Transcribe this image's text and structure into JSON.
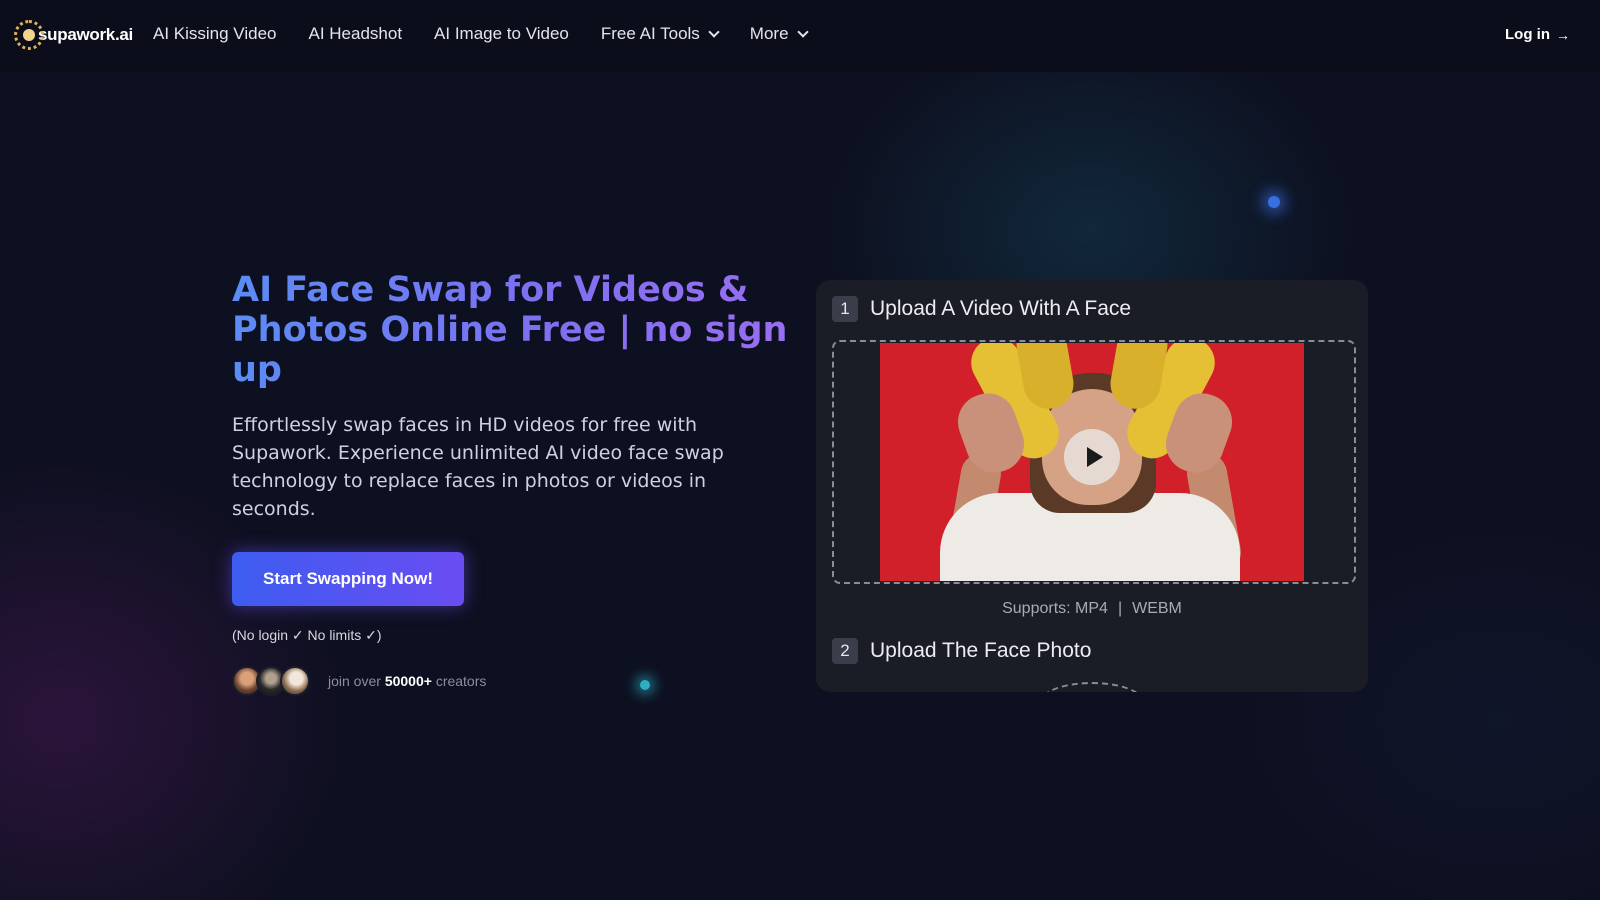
{
  "brand": {
    "logo_text": "supawork.ai"
  },
  "nav": {
    "links": [
      {
        "label": "AI Kissing Video"
      },
      {
        "label": "AI Headshot"
      },
      {
        "label": "AI Image to Video"
      },
      {
        "label": "Free AI Tools"
      },
      {
        "label": "More"
      }
    ],
    "login_label": "Log in",
    "login_arrow": "→"
  },
  "hero": {
    "title": "AI Face Swap for Videos & Photos Online Free | no sign up",
    "description": "Effortlessly swap faces in HD videos for free with Supawork. Experience unlimited AI video face swap technology to replace faces in photos or videos in seconds.",
    "cta_label": "Start Swapping Now!",
    "no_login_note": "(No login ✓ No limits ✓)",
    "creators_prefix": "join over",
    "creators_count": "50000+",
    "creators_suffix": "creators"
  },
  "panel": {
    "step1": {
      "number": "1",
      "title": "Upload A Video With A Face"
    },
    "supports_label": "Supports: MP4",
    "supports_sep": "|",
    "supports_format2": "WEBM",
    "step2": {
      "number": "2",
      "title": "Upload The Face Photo"
    }
  },
  "colors": {
    "background": "#0d1020",
    "cta_start": "#3d5cf0",
    "cta_end": "#6a4df2",
    "title_gradient_start": "#5b8cf5",
    "title_gradient_end": "#9a6ef0",
    "video_bg": "#d2202a"
  },
  "icons": {
    "logo": "sun-dots-logo-icon",
    "dropdown": "chevron-down-icon",
    "login": "arrow-right-icon",
    "play": "play-icon"
  }
}
